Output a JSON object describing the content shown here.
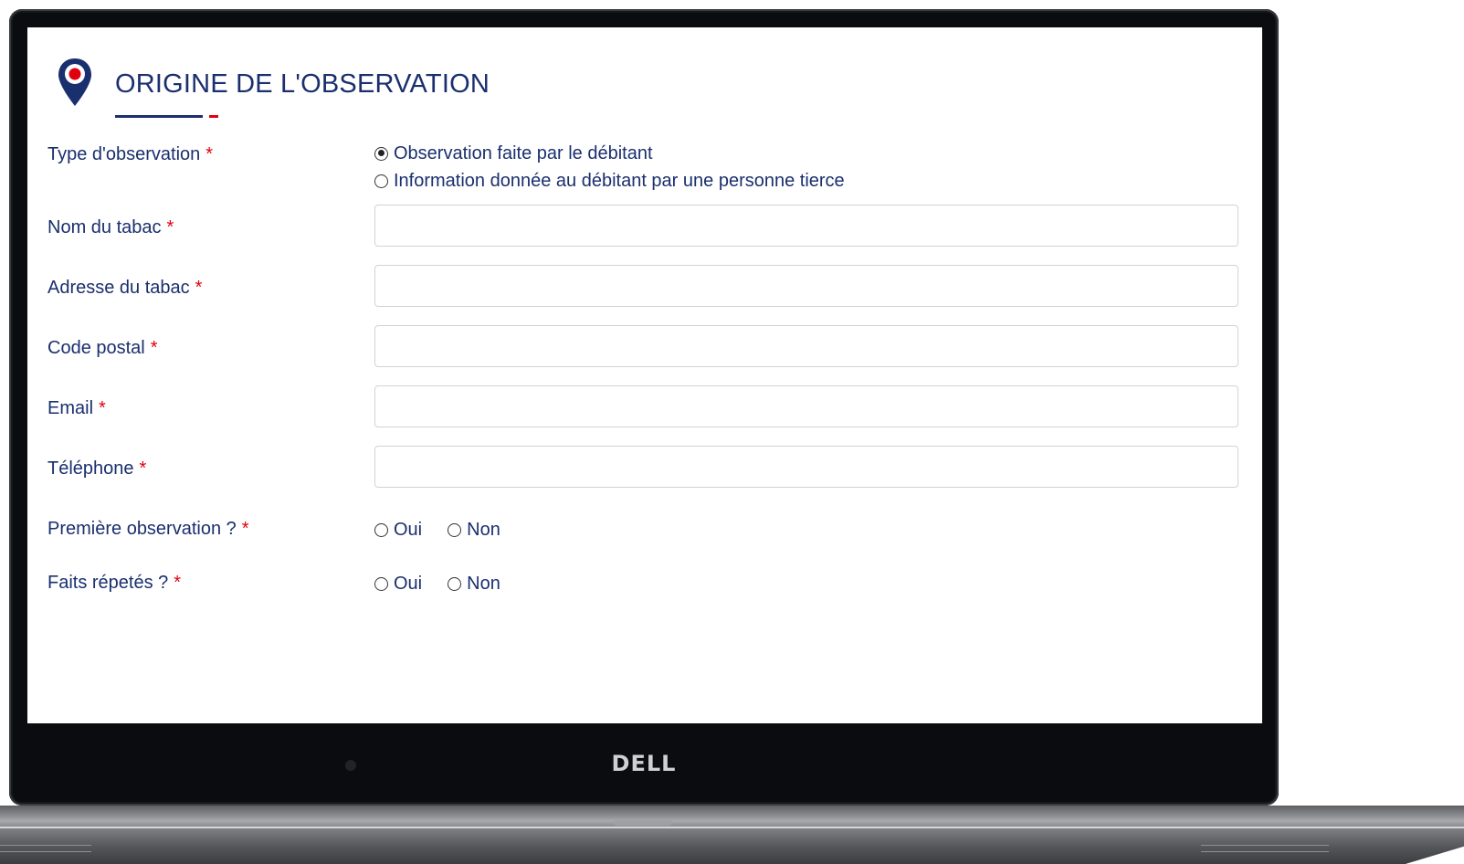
{
  "device": {
    "brand": "DELL"
  },
  "form": {
    "title": "ORIGINE DE L'OBSERVATION",
    "required_mark": "*",
    "colors": {
      "primary": "#1a2f6e",
      "accent": "#e1000f"
    },
    "type_observation": {
      "label": "Type d'observation",
      "options": [
        {
          "label": "Observation faite par le débitant",
          "checked": true
        },
        {
          "label": "Information donnée au débitant par une personne tierce",
          "checked": false
        }
      ]
    },
    "fields": [
      {
        "label": "Nom du tabac",
        "value": "",
        "placeholder": ""
      },
      {
        "label": "Adresse du tabac",
        "value": "",
        "placeholder": ""
      },
      {
        "label": "Code postal",
        "value": "",
        "placeholder": ""
      },
      {
        "label": "Email",
        "value": "",
        "placeholder": ""
      },
      {
        "label": "Téléphone",
        "value": "",
        "placeholder": ""
      }
    ],
    "premiere_observation": {
      "label": "Première observation ?",
      "options": [
        "Oui",
        "Non"
      ]
    },
    "faits_repetes": {
      "label": "Faits répetés ?",
      "options": [
        "Oui",
        "Non"
      ]
    }
  }
}
